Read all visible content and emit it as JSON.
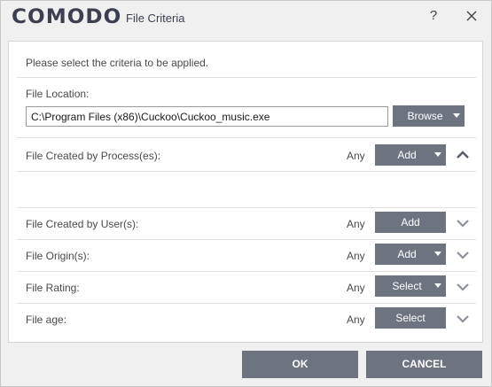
{
  "titlebar": {
    "logo": "COMODO",
    "title": "File Criteria",
    "help": "?"
  },
  "panel": {
    "intro": "Please select the criteria to be applied.",
    "file_location": {
      "label": "File Location:",
      "value": "C:\\Program Files (x86)\\Cuckoo\\Cuckoo_music.exe",
      "browse_label": "Browse"
    },
    "rows": [
      {
        "label": "File Created by Process(es):",
        "any": "Any",
        "button": "Add",
        "expanded": true
      },
      {
        "label": "File Created by User(s):",
        "any": "Any",
        "button": "Add",
        "expanded": false
      },
      {
        "label": "File Origin(s):",
        "any": "Any",
        "button": "Add",
        "expanded": false
      },
      {
        "label": "File Rating:",
        "any": "Any",
        "button": "Select",
        "expanded": false
      },
      {
        "label": "File age:",
        "any": "Any",
        "button": "Select",
        "expanded": false
      }
    ]
  },
  "footer": {
    "ok_label": "OK",
    "cancel_label": "CANCEL"
  },
  "colors": {
    "button": "#6e7380",
    "text": "#4a4a4a",
    "chevron": "#6e7380"
  }
}
